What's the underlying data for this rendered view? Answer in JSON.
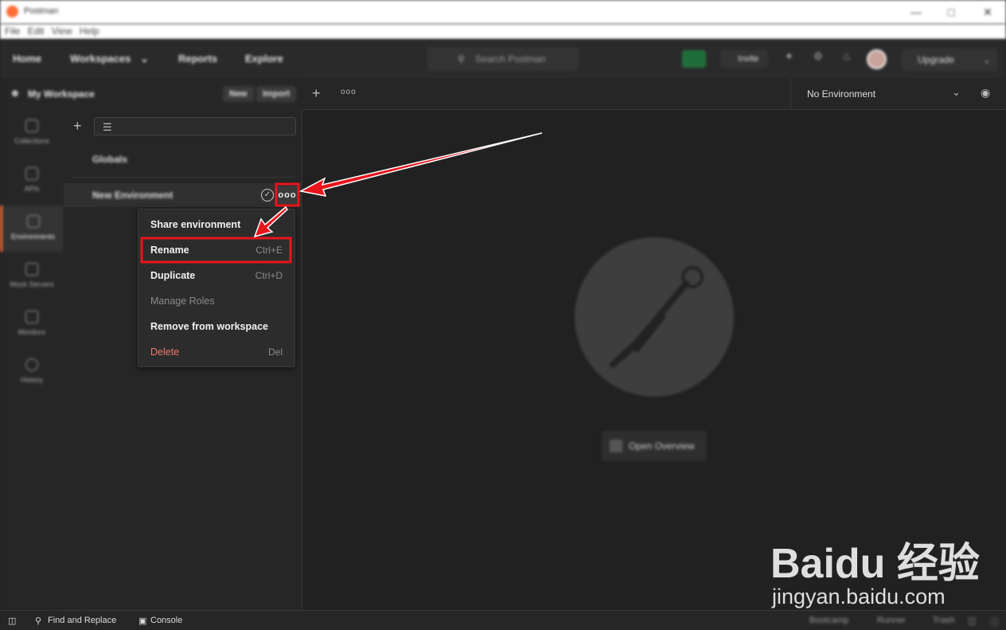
{
  "window": {
    "title": "Postman",
    "menu": [
      "File",
      "Edit",
      "View",
      "Help"
    ]
  },
  "header": {
    "nav": [
      "Home",
      "Workspaces",
      "Reports",
      "Explore"
    ],
    "search_placeholder": "Search Postman",
    "invite_label": "Invite",
    "upgrade_label": "Upgrade"
  },
  "workspace": {
    "title": "My Workspace",
    "new_label": "New",
    "import_label": "Import"
  },
  "sidebar": {
    "items": [
      {
        "label": "Collections",
        "icon": "collections-icon"
      },
      {
        "label": "APIs",
        "icon": "apis-icon"
      },
      {
        "label": "Environments",
        "icon": "environments-icon",
        "active": true
      },
      {
        "label": "Mock Servers",
        "icon": "mock-servers-icon"
      },
      {
        "label": "Monitors",
        "icon": "monitors-icon"
      },
      {
        "label": "History",
        "icon": "history-icon"
      }
    ]
  },
  "environments": {
    "globals_label": "Globals",
    "selected_env": "New Environment",
    "more_label": "ooo"
  },
  "context_menu": {
    "items": [
      {
        "label": "Share environment",
        "shortcut": ""
      },
      {
        "label": "Rename",
        "shortcut": "Ctrl+E"
      },
      {
        "label": "Duplicate",
        "shortcut": "Ctrl+D"
      },
      {
        "label": "Manage Roles",
        "shortcut": ""
      },
      {
        "label": "Remove from workspace",
        "shortcut": ""
      },
      {
        "label": "Delete",
        "shortcut": "Del"
      }
    ]
  },
  "tabbar": {
    "more_label": "ooo",
    "environment_select": "No Environment"
  },
  "main": {
    "open_overview_label": "Open Overview"
  },
  "footer": {
    "find_replace": "Find and Replace",
    "console": "Console",
    "bootcamp": "Bootcamp",
    "runner": "Runner",
    "trash": "Trash"
  },
  "watermark": {
    "brand": "Baidu 经验",
    "url": "jingyan.baidu.com"
  },
  "colors": {
    "accent": "#ff6c37",
    "highlight": "#e8141b",
    "danger_text": "#f07a6e"
  }
}
